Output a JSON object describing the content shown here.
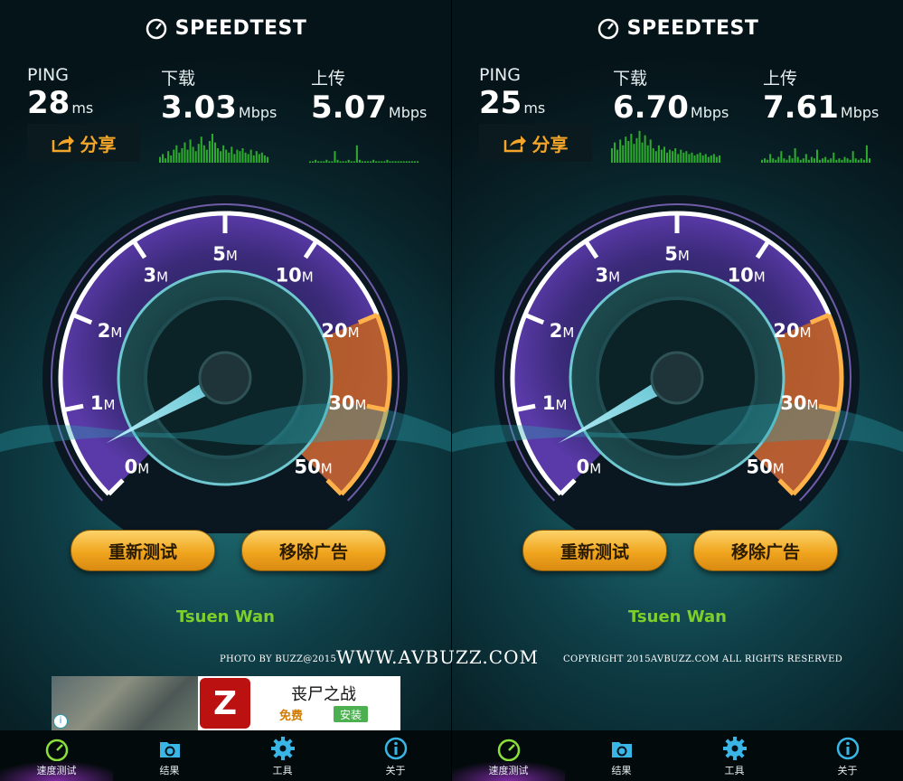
{
  "panels": [
    {
      "brand": "SPEEDTEST",
      "ping": {
        "label": "PING",
        "value": "28",
        "unit": "ms"
      },
      "download": {
        "label": "下载",
        "value": "3.03",
        "unit": "Mbps"
      },
      "upload": {
        "label": "上传",
        "value": "5.07",
        "unit": "Mbps"
      },
      "share_label": "分享",
      "gauge_ticks": [
        "0",
        "1",
        "2",
        "3",
        "5",
        "10",
        "20",
        "30",
        "50"
      ],
      "gauge_unit": "M",
      "needle_fraction": 0.06,
      "buttons": {
        "retest": "重新测试",
        "remove_ads": "移除广告"
      },
      "location": "Tsuen Wan"
    },
    {
      "brand": "SPEEDTEST",
      "ping": {
        "label": "PING",
        "value": "25",
        "unit": "ms"
      },
      "download": {
        "label": "下载",
        "value": "6.70",
        "unit": "Mbps"
      },
      "upload": {
        "label": "上传",
        "value": "7.61",
        "unit": "Mbps"
      },
      "share_label": "分享",
      "gauge_ticks": [
        "0",
        "1",
        "2",
        "3",
        "5",
        "10",
        "20",
        "30",
        "50"
      ],
      "gauge_unit": "M",
      "needle_fraction": 0.06,
      "buttons": {
        "retest": "重新测试",
        "remove_ads": "移除广告"
      },
      "location": "Tsuen Wan"
    }
  ],
  "watermark": {
    "photo_by": "PHOTO BY BUZZ@2015",
    "site": "WWW.AVBUZZ.COM",
    "copyright": "COPYRIGHT 2015AVBUZZ.COM ALL RIGHTS RESERVED"
  },
  "ad": {
    "title": "丧尸之战",
    "free": "免费",
    "install": "安装",
    "icon_letter": "Z"
  },
  "tabs": [
    {
      "label": "速度测试",
      "icon": "speedometer-icon"
    },
    {
      "label": "结果",
      "icon": "results-folder-icon"
    },
    {
      "label": "工具",
      "icon": "gear-icon"
    },
    {
      "label": "关于",
      "icon": "info-icon"
    }
  ],
  "colors": {
    "accent": "#f4a62a",
    "location": "#7fcf2a",
    "gauge_fill": "#3a2a78",
    "gauge_hot": "#c8641e"
  }
}
